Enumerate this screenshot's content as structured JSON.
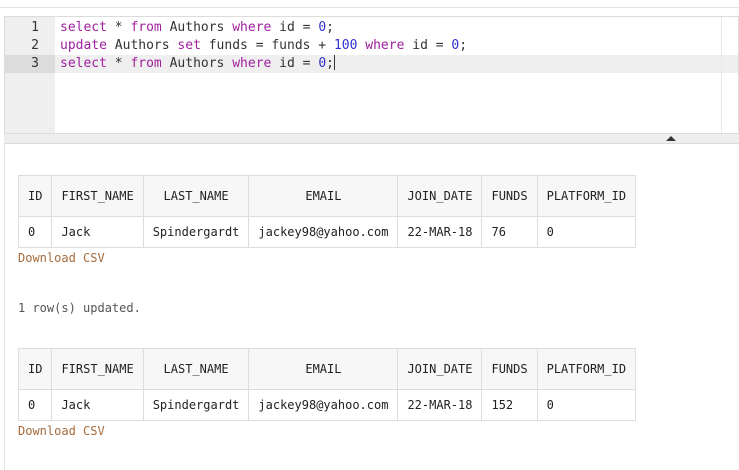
{
  "editor": {
    "line_numbers": [
      "1",
      "2",
      "3"
    ],
    "lines": [
      [
        {
          "t": "select",
          "k": "kw"
        },
        {
          "t": " * "
        },
        {
          "t": "from",
          "k": "kw"
        },
        {
          "t": " Authors "
        },
        {
          "t": "where",
          "k": "kw"
        },
        {
          "t": " id = "
        },
        {
          "t": "0",
          "k": "num"
        },
        {
          "t": ";"
        }
      ],
      [
        {
          "t": "update",
          "k": "kw"
        },
        {
          "t": " Authors "
        },
        {
          "t": "set",
          "k": "kw"
        },
        {
          "t": " funds = funds + "
        },
        {
          "t": "100",
          "k": "num"
        },
        {
          "t": " "
        },
        {
          "t": "where",
          "k": "kw"
        },
        {
          "t": " id = "
        },
        {
          "t": "0",
          "k": "num"
        },
        {
          "t": ";"
        }
      ],
      [
        {
          "t": "select",
          "k": "kw"
        },
        {
          "t": " * "
        },
        {
          "t": "from",
          "k": "kw"
        },
        {
          "t": " Authors "
        },
        {
          "t": "where",
          "k": "kw"
        },
        {
          "t": " id = "
        },
        {
          "t": "0",
          "k": "num"
        },
        {
          "t": ";"
        }
      ]
    ],
    "active_line": 3
  },
  "results": [
    {
      "columns": [
        "ID",
        "FIRST_NAME",
        "LAST_NAME",
        "EMAIL",
        "JOIN_DATE",
        "FUNDS",
        "PLATFORM_ID"
      ],
      "rows": [
        [
          "0",
          "Jack",
          "Spindergardt",
          "jackey98@yahoo.com",
          "22-MAR-18",
          "76",
          "0"
        ]
      ],
      "download_label": "Download CSV"
    },
    {
      "columns": [
        "ID",
        "FIRST_NAME",
        "LAST_NAME",
        "EMAIL",
        "JOIN_DATE",
        "FUNDS",
        "PLATFORM_ID"
      ],
      "rows": [
        [
          "0",
          "Jack",
          "Spindergardt",
          "jackey98@yahoo.com",
          "22-MAR-18",
          "152",
          "0"
        ]
      ],
      "download_label": "Download CSV"
    }
  ],
  "status_message": "1 row(s) updated."
}
